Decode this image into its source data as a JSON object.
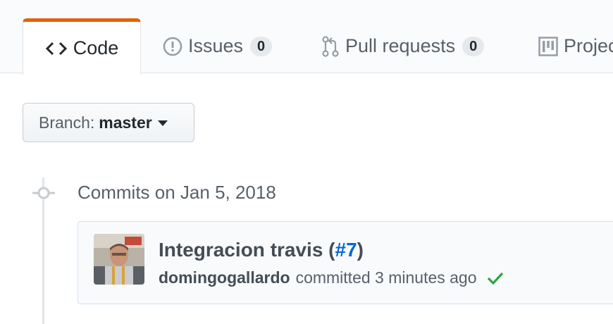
{
  "tabs": [
    {
      "label": "Code",
      "icon": "code-icon",
      "selected": true
    },
    {
      "label": "Issues",
      "icon": "issue-opened-icon",
      "count": "0"
    },
    {
      "label": "Pull requests",
      "icon": "git-pull-request-icon",
      "count": "0"
    },
    {
      "label": "Projec",
      "icon": "project-icon"
    }
  ],
  "branch": {
    "label": "Branch:",
    "name": "master"
  },
  "commits_group": {
    "date_heading": "Commits on Jan 5, 2018"
  },
  "commit": {
    "title": "Integracion travis (",
    "pr_link": "#7",
    "title_suffix": ")",
    "author": "domingogallardo",
    "committed_text": "committed 3 minutes ago",
    "status": "success",
    "status_icon": "check-icon",
    "avatar": "author-avatar"
  },
  "colors": {
    "selected_tab_accent": "#e36209",
    "link": "#0366d6",
    "success": "#28a745"
  }
}
